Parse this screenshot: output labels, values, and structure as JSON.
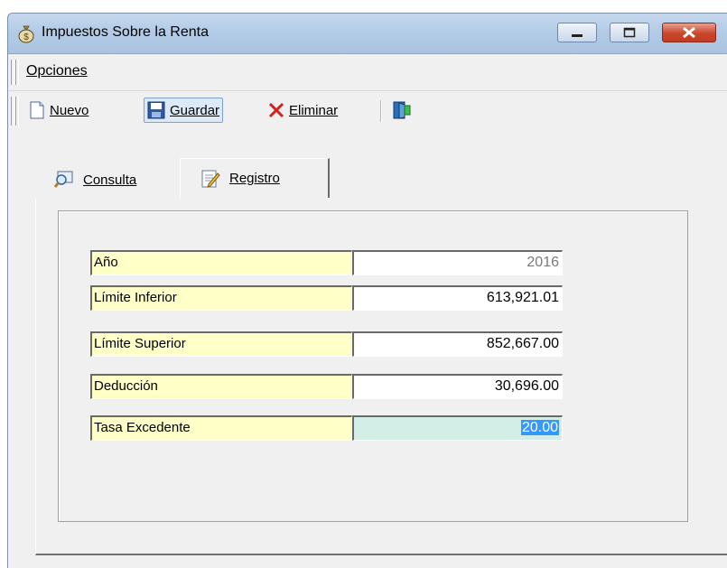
{
  "window": {
    "title": "Impuestos Sobre la Renta",
    "icon": "money-bag-icon"
  },
  "menu": {
    "items": [
      {
        "label": "Opciones"
      }
    ]
  },
  "toolbar": {
    "nuevo_label": "Nuevo",
    "guardar_label": "Guardar",
    "eliminar_label": "Eliminar"
  },
  "tabs": [
    {
      "label": "Consulta",
      "icon": "magnifier-icon"
    },
    {
      "label": "Registro",
      "icon": "edit-document-icon",
      "selected": true
    }
  ],
  "form": {
    "fields": [
      {
        "label": "Año",
        "value": "2016"
      },
      {
        "label": "Límite Inferior",
        "value": "613,921.01"
      },
      {
        "label": "Límite Superior",
        "value": "852,667.00"
      },
      {
        "label": "Deducción",
        "value": "30,696.00"
      },
      {
        "label": "Tasa Excedente",
        "value": "20.00"
      }
    ]
  },
  "colors": {
    "label_bg": "#ffffc8",
    "focused_field_bg": "#d2eee6",
    "selection": "#3399ff",
    "delete_icon": "#d42020"
  }
}
